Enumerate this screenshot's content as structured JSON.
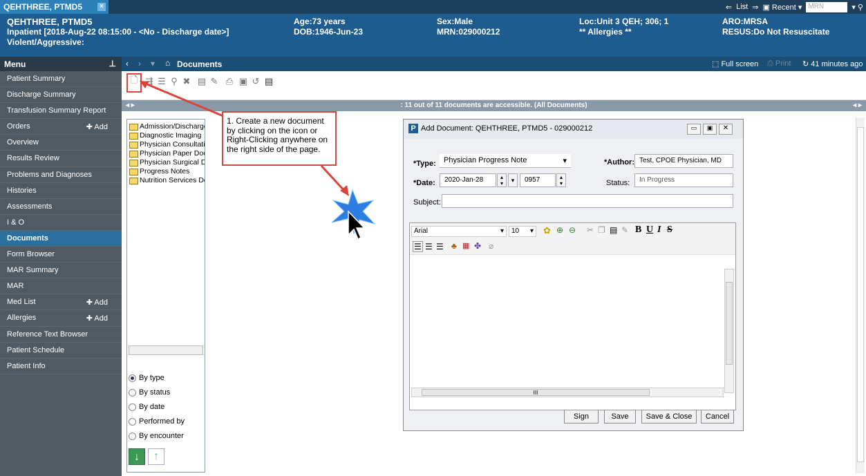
{
  "tab": {
    "title": "QEHTHREE, PTMD5",
    "close": "×"
  },
  "topright": {
    "list": "List",
    "recent": "Recent",
    "mrn_placeholder": "MRN"
  },
  "banner": {
    "name": "QEHTHREE, PTMD5",
    "encounter": "Inpatient [2018-Aug-22 08:15:00 - <No - Discharge date>]",
    "violent": "Violent/Aggressive:",
    "age": "Age:73 years",
    "dob": "DOB:1946-Jun-23",
    "sex": "Sex:Male",
    "mrn": "MRN:029000212",
    "loc": "Loc:Unit 3 QEH; 306; 1",
    "allergies": "** Allergies **",
    "aro": "ARO:MRSA",
    "resus": "RESUS:Do Not Resuscitate"
  },
  "menu": {
    "header": "Menu",
    "items": [
      {
        "label": "Patient Summary",
        "add": ""
      },
      {
        "label": "Discharge Summary",
        "add": ""
      },
      {
        "label": "Transfusion Summary Report",
        "add": ""
      },
      {
        "label": "Orders",
        "add": "Add"
      },
      {
        "label": "Overview",
        "add": ""
      },
      {
        "label": "Results Review",
        "add": ""
      },
      {
        "label": "Problems and Diagnoses",
        "add": ""
      },
      {
        "label": "Histories",
        "add": ""
      },
      {
        "label": "Assessments",
        "add": ""
      },
      {
        "label": "I & O",
        "add": ""
      },
      {
        "label": "Documents",
        "add": ""
      },
      {
        "label": "Form Browser",
        "add": ""
      },
      {
        "label": "MAR Summary",
        "add": ""
      },
      {
        "label": "MAR",
        "add": ""
      },
      {
        "label": "Med List",
        "add": "Add"
      },
      {
        "label": "Allergies",
        "add": "Add"
      },
      {
        "label": "Reference Text Browser",
        "add": ""
      },
      {
        "label": "Patient Schedule",
        "add": ""
      },
      {
        "label": "Patient Info",
        "add": ""
      }
    ]
  },
  "nav": {
    "title": "Documents",
    "fullscreen": "Full screen",
    "print": "Print",
    "refresh": "41 minutes ago"
  },
  "status_strip": ": 11 out of 11 documents are accessible. (All Documents)",
  "tree": [
    "Admission/Discharge",
    "Diagnostic Imaging",
    "Physician Consultatio",
    "Physician Paper Docu",
    "Physician Surgical Do",
    "Progress Notes",
    "Nutrition Services Do"
  ],
  "radios": [
    "By type",
    "By status",
    "By date",
    "Performed by",
    "By encounter"
  ],
  "callout": "1. Create a new document by clicking on the icon or Right-Clicking anywhere on the right side of the page.",
  "dialog": {
    "title": "Add Document: QEHTHREE, PTMD5 - 029000212",
    "type_label": "*Type:",
    "type_value": "Physician Progress Note",
    "author_label": "*Author:",
    "author_value": "Test, CPOE Physician, MD",
    "date_label": "*Date:",
    "date_value": "2020-Jan-28",
    "time_value": "0957",
    "status_label": "Status:",
    "status_value": "In Progress",
    "subject_label": "Subject:",
    "subject_value": "",
    "font": "Arial",
    "size": "10",
    "scroll_mark": "III",
    "buttons": {
      "sign": "Sign",
      "save": "Save",
      "save_close": "Save & Close",
      "cancel": "Cancel"
    }
  }
}
